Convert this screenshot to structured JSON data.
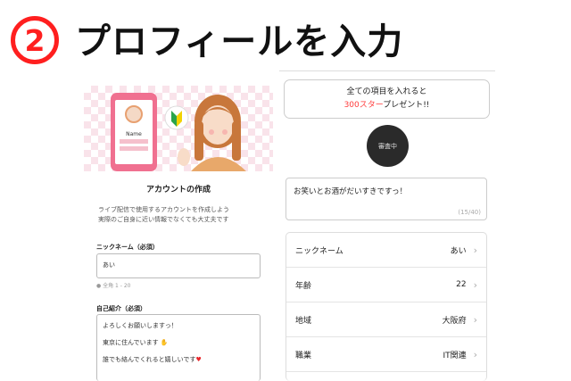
{
  "heading": {
    "step": "2",
    "title": "プロフィールを入力"
  },
  "left": {
    "phone_name": "Name",
    "title": "アカウントの作成",
    "desc_line1": "ライブ配信で使用するアカウントを作成しよう",
    "desc_line2": "実際のご自身に近い情報でなくても大丈夫です",
    "nickname_label": "ニックネーム（必須）",
    "nickname_value": "あい",
    "nickname_hint": "● 全角 1 - 20",
    "intro_label": "自己紹介（必須）",
    "intro_line1": "よろしくお願いしますっ！",
    "intro_line2": "東京に住んでいます",
    "intro_line3": "誰でも絡んでくれると嬉しいです"
  },
  "right": {
    "banner_line1": "全ての項目を入れると",
    "banner_em": "300スター",
    "banner_tail": "プレゼント!!",
    "avatar_status": "審査中",
    "bio_text": "お笑いとお酒がだいすきですっ！",
    "bio_counter": "(15/40)",
    "rows": [
      {
        "label": "ニックネーム",
        "value": "あい"
      },
      {
        "label": "年齢",
        "value": "22"
      },
      {
        "label": "地域",
        "value": "大阪府"
      },
      {
        "label": "職業",
        "value": "IT関連"
      }
    ]
  },
  "colors": {
    "accent": "#ff1f1f",
    "banner_em": "#ff3b3b",
    "phone": "#f07090"
  },
  "icons": [
    "step-number-circle",
    "chevron-right-icon",
    "heart-icon",
    "hands-icon",
    "beginner-leaf-icon"
  ]
}
